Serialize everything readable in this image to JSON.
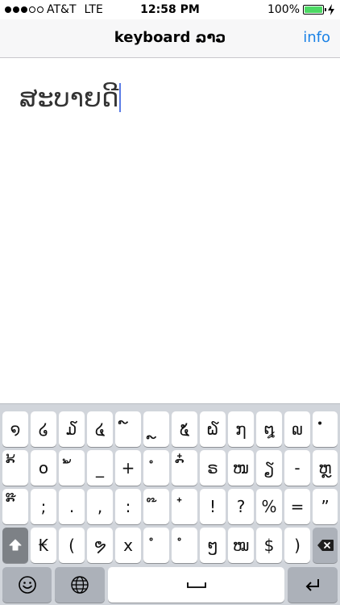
{
  "status_bar": {
    "carrier": "AT&T",
    "network": "LTE",
    "time": "12:58 PM",
    "battery_percent": "100%",
    "signal_bars_filled": 3,
    "signal_bars_total": 5,
    "battery_level": 1.0
  },
  "nav": {
    "title": "keyboard ລາວ",
    "info_label": "info"
  },
  "editor": {
    "text": "ສະບາຍດີ"
  },
  "keyboard": {
    "row1": [
      "໑",
      "໒",
      "໓",
      "໔",
      "໌",
      "ຼ",
      "໕",
      "໖",
      "໗",
      "໘",
      "໙",
      "ໍ່"
    ],
    "row2": [
      "ົ້",
      "໐",
      "ໍ້",
      "_",
      "+",
      "ໍ",
      "ົ໋",
      "ຣ",
      "ໜ",
      "ຽ",
      "-",
      "ຫຼ"
    ],
    "row3": [
      "ົ໊",
      ";",
      ".",
      ",",
      ":",
      "໊",
      "໋",
      "!",
      "?",
      "%",
      "=",
      "”"
    ],
    "row4": [
      "₭",
      "(",
      "ຯ",
      "x",
      "ໍ",
      "ໍ",
      "ໆ",
      "ໝ",
      "$",
      ")"
    ],
    "icons": {
      "shift": "shift-arrow-icon",
      "backspace": "backspace-icon",
      "emoji": "smiley-icon",
      "globe": "globe-icon",
      "space": "space-bar-icon",
      "return": "return-arrow-icon"
    },
    "colors": {
      "keyboard_bg": "#d1d5db",
      "key_bg": "#ffffff",
      "function_key_bg": "#acb1b9",
      "shift_key_bg": "#7d8186",
      "accent": "#1a82e6",
      "caret": "#5b7ce6"
    }
  }
}
